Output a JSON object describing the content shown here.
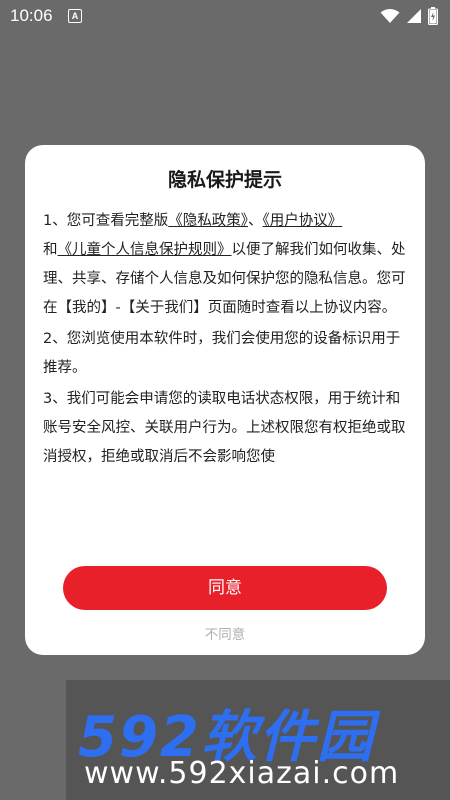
{
  "status_bar": {
    "time": "10:06",
    "notification_icon": "A"
  },
  "dialog": {
    "title": "隐私保护提示",
    "p1": {
      "prefix": "1、您可查看完整版",
      "link1": "《隐私政策》",
      "sep": "、",
      "link2": "《用户协议》",
      "and": "和",
      "link3": "《儿童个人信息保护规则》",
      "suffix": "以便了解我们如何收集、处理、共享、存储个人信息及如何保护您的隐私信息。您可在【我的】-【关于我们】页面随时查看以上协议内容。"
    },
    "p2": "2、您浏览使用本软件时，我们会使用您的设备标识用于推荐。",
    "p3": "3、我们可能会申请您的读取电话状态权限，用于统计和账号安全风控、关联用户行为。上述权限您有权拒绝或取消授权，拒绝或取消后不会影响您使",
    "agree_label": "同意",
    "disagree_label": "不同意"
  },
  "watermark": {
    "logo_text": "592软件园",
    "url": "www.592xiazai.com"
  }
}
